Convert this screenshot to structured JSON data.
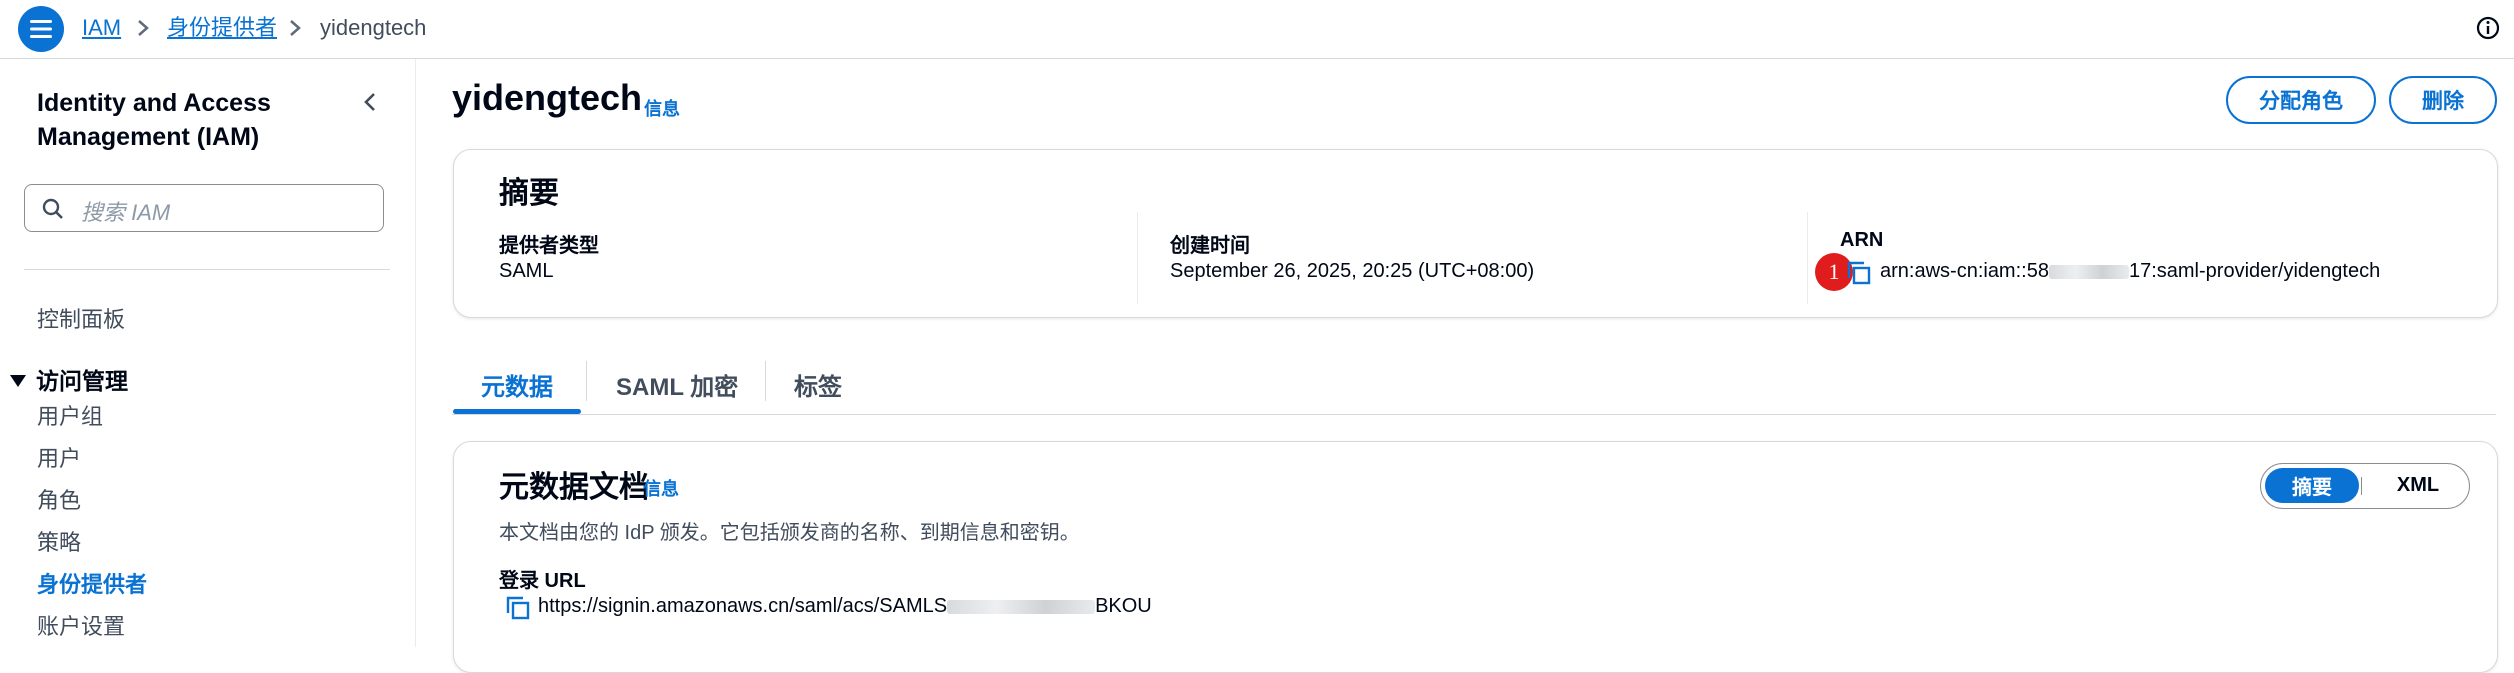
{
  "breadcrumb": {
    "items": [
      "IAM",
      "身份提供者",
      "yidengtech"
    ]
  },
  "sidebar": {
    "title": "Identity and Access Management (IAM)",
    "search_placeholder": "搜索 IAM",
    "dashboard": "控制面板",
    "group_label": "访问管理",
    "items": [
      "用户组",
      "用户",
      "角色",
      "策略",
      "身份提供者",
      "账户设置"
    ],
    "active_item": "身份提供者"
  },
  "page": {
    "title": "yidengtech",
    "info": "信息",
    "actions": {
      "assign_role": "分配角色",
      "delete": "删除"
    }
  },
  "summary": {
    "heading": "摘要",
    "provider_type_label": "提供者类型",
    "provider_type_value": "SAML",
    "created_label": "创建时间",
    "created_value": "September 26, 2025, 20:25 (UTC+08:00)",
    "arn_label": "ARN",
    "arn_prefix": "arn:aws-cn:iam::58",
    "arn_suffix": "17:saml-provider/yidengtech",
    "annotation_number": "1"
  },
  "tabs": [
    "元数据",
    "SAML 加密",
    "标签"
  ],
  "active_tab": "元数据",
  "metadata": {
    "heading": "元数据文档",
    "info": "信息",
    "description": "本文档由您的 IdP 颁发。它包括颁发商的名称、到期信息和密钥。",
    "login_url_label": "登录 URL",
    "login_url_prefix": "https://signin.amazonaws.cn/saml/acs/SAMLS",
    "login_url_suffix": "BKOU",
    "view_toggle": {
      "summary": "摘要",
      "xml": "XML",
      "selected": "摘要"
    }
  },
  "colors": {
    "accent": "#0972d3",
    "annotation": "#e11c1c"
  }
}
